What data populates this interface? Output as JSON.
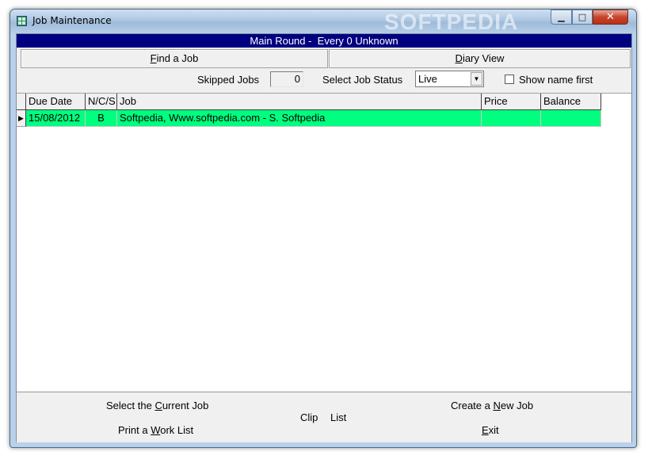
{
  "window": {
    "title": "Job Maintenance",
    "watermark": "SOFTPEDIA",
    "controls": {
      "minimize": "▁",
      "maximize": "□",
      "close": "✕"
    }
  },
  "round_bar": {
    "text": "Main Round -  Every 0 Unknown"
  },
  "top_buttons": {
    "find_job": {
      "mnemonic": "F",
      "rest": "ind a Job"
    },
    "diary_view": {
      "mnemonic": "D",
      "rest": "iary View"
    }
  },
  "filters": {
    "skipped_jobs_label": "Skipped Jobs",
    "skipped_jobs_value": "0",
    "select_status_label": "Select Job Status",
    "status_value": "Live",
    "dropdown_arrow": "▼",
    "show_name_first_label": "Show name first",
    "show_name_first_checked": false
  },
  "grid": {
    "columns": [
      "Due Date",
      "N/C/S",
      "Job",
      "Price",
      "Balance"
    ],
    "row_indicator": "▶",
    "rows": [
      {
        "due_date": "15/08/2012",
        "ncs": "B",
        "job": "Softpedia, Www.softpedia.com - S. Softpedia",
        "price": "",
        "balance": ""
      }
    ],
    "highlight_color": "#00ff7f"
  },
  "actions": {
    "select_current": {
      "before": "Select the ",
      "mnemonic": "C",
      "after": "urrent Job"
    },
    "create_new": {
      "before": "Create a ",
      "mnemonic": "N",
      "after": "ew Job"
    },
    "print_work": {
      "before": "Print a ",
      "mnemonic": "W",
      "after": "ork List"
    },
    "exit": {
      "before": "",
      "mnemonic": "E",
      "after": "xit"
    },
    "clip": "Clip",
    "list": "List"
  },
  "colors": {
    "title_bar_blue": "#000080"
  }
}
